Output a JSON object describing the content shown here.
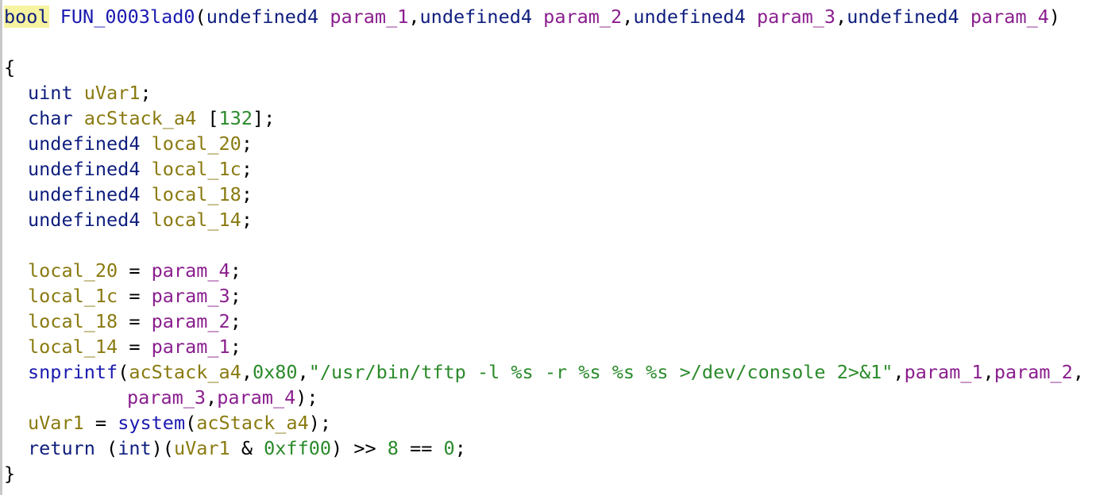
{
  "colors": {
    "type": "#0e1e7e",
    "function": "#1a1ab0",
    "parameter": "#8a1e8e",
    "local_variable": "#8a7a10",
    "literal": "#2a8a2a",
    "punctuation": "#000000",
    "highlight": "#f7f3a0",
    "background": "#ffffff"
  },
  "lines": [
    [
      {
        "t": "bool",
        "k": "type",
        "hl": true
      },
      {
        "t": " ",
        "k": "punct"
      },
      {
        "t": "FUN_0003lad0",
        "k": "fn"
      },
      {
        "t": "(",
        "k": "punct"
      },
      {
        "t": "undefined4",
        "k": "type"
      },
      {
        "t": " ",
        "k": "punct"
      },
      {
        "t": "param_1",
        "k": "param"
      },
      {
        "t": ",",
        "k": "punct"
      },
      {
        "t": "undefined4",
        "k": "type"
      },
      {
        "t": " ",
        "k": "punct"
      },
      {
        "t": "param_2",
        "k": "param"
      },
      {
        "t": ",",
        "k": "punct"
      },
      {
        "t": "undefined4",
        "k": "type"
      },
      {
        "t": " ",
        "k": "punct"
      },
      {
        "t": "param_3",
        "k": "param"
      },
      {
        "t": ",",
        "k": "punct"
      },
      {
        "t": "undefined4",
        "k": "type"
      },
      {
        "t": " ",
        "k": "punct"
      },
      {
        "t": "param_4",
        "k": "param"
      },
      {
        "t": ")",
        "k": "punct"
      }
    ],
    [],
    [
      {
        "t": "{",
        "k": "punct"
      }
    ],
    [
      {
        "t": "uint",
        "k": "type",
        "ind": true
      },
      {
        "t": " ",
        "k": "punct"
      },
      {
        "t": "uVar1",
        "k": "local"
      },
      {
        "t": ";",
        "k": "punct"
      }
    ],
    [
      {
        "t": "char",
        "k": "type",
        "ind": true
      },
      {
        "t": " ",
        "k": "punct"
      },
      {
        "t": "acStack_a4",
        "k": "local"
      },
      {
        "t": " [",
        "k": "punct"
      },
      {
        "t": "132",
        "k": "num"
      },
      {
        "t": "];",
        "k": "punct"
      }
    ],
    [
      {
        "t": "undefined4",
        "k": "type",
        "ind": true
      },
      {
        "t": " ",
        "k": "punct"
      },
      {
        "t": "local_20",
        "k": "local"
      },
      {
        "t": ";",
        "k": "punct"
      }
    ],
    [
      {
        "t": "undefined4",
        "k": "type",
        "ind": true
      },
      {
        "t": " ",
        "k": "punct"
      },
      {
        "t": "local_1c",
        "k": "local"
      },
      {
        "t": ";",
        "k": "punct"
      }
    ],
    [
      {
        "t": "undefined4",
        "k": "type",
        "ind": true
      },
      {
        "t": " ",
        "k": "punct"
      },
      {
        "t": "local_18",
        "k": "local"
      },
      {
        "t": ";",
        "k": "punct"
      }
    ],
    [
      {
        "t": "undefined4",
        "k": "type",
        "ind": true
      },
      {
        "t": " ",
        "k": "punct"
      },
      {
        "t": "local_14",
        "k": "local"
      },
      {
        "t": ";",
        "k": "punct"
      }
    ],
    [],
    [
      {
        "t": "local_20",
        "k": "local",
        "ind": true
      },
      {
        "t": " = ",
        "k": "punct"
      },
      {
        "t": "param_4",
        "k": "param"
      },
      {
        "t": ";",
        "k": "punct"
      }
    ],
    [
      {
        "t": "local_1c",
        "k": "local",
        "ind": true
      },
      {
        "t": " = ",
        "k": "punct"
      },
      {
        "t": "param_3",
        "k": "param"
      },
      {
        "t": ";",
        "k": "punct"
      }
    ],
    [
      {
        "t": "local_18",
        "k": "local",
        "ind": true
      },
      {
        "t": " = ",
        "k": "punct"
      },
      {
        "t": "param_2",
        "k": "param"
      },
      {
        "t": ";",
        "k": "punct"
      }
    ],
    [
      {
        "t": "local_14",
        "k": "local",
        "ind": true
      },
      {
        "t": " = ",
        "k": "punct"
      },
      {
        "t": "param_1",
        "k": "param"
      },
      {
        "t": ";",
        "k": "punct"
      }
    ],
    [
      {
        "t": "snprintf",
        "k": "fn",
        "ind": true
      },
      {
        "t": "(",
        "k": "punct"
      },
      {
        "t": "acStack_a4",
        "k": "local"
      },
      {
        "t": ",",
        "k": "punct"
      },
      {
        "t": "0x80",
        "k": "num"
      },
      {
        "t": ",",
        "k": "punct"
      },
      {
        "t": "\"/usr/bin/tftp -l %s -r %s %s %s >/dev/console 2>&1\"",
        "k": "str"
      },
      {
        "t": ",",
        "k": "punct"
      },
      {
        "t": "param_1",
        "k": "param"
      },
      {
        "t": ",",
        "k": "punct"
      },
      {
        "t": "param_2",
        "k": "param"
      },
      {
        "t": ",",
        "k": "punct"
      }
    ],
    [
      {
        "t": "param_3",
        "k": "param",
        "cont": true
      },
      {
        "t": ",",
        "k": "punct"
      },
      {
        "t": "param_4",
        "k": "param"
      },
      {
        "t": ");",
        "k": "punct"
      }
    ],
    [
      {
        "t": "uVar1",
        "k": "local",
        "ind": true
      },
      {
        "t": " = ",
        "k": "punct"
      },
      {
        "t": "system",
        "k": "fn"
      },
      {
        "t": "(",
        "k": "punct"
      },
      {
        "t": "acStack_a4",
        "k": "local"
      },
      {
        "t": ");",
        "k": "punct"
      }
    ],
    [
      {
        "t": "return",
        "k": "kw",
        "ind": true
      },
      {
        "t": " (",
        "k": "punct"
      },
      {
        "t": "int",
        "k": "type"
      },
      {
        "t": ")(",
        "k": "punct"
      },
      {
        "t": "uVar1",
        "k": "local"
      },
      {
        "t": " & ",
        "k": "punct"
      },
      {
        "t": "0xff00",
        "k": "num"
      },
      {
        "t": ") >> ",
        "k": "punct"
      },
      {
        "t": "8",
        "k": "num"
      },
      {
        "t": " == ",
        "k": "punct"
      },
      {
        "t": "0",
        "k": "num"
      },
      {
        "t": ";",
        "k": "punct"
      }
    ],
    [
      {
        "t": "}",
        "k": "punct"
      }
    ]
  ]
}
